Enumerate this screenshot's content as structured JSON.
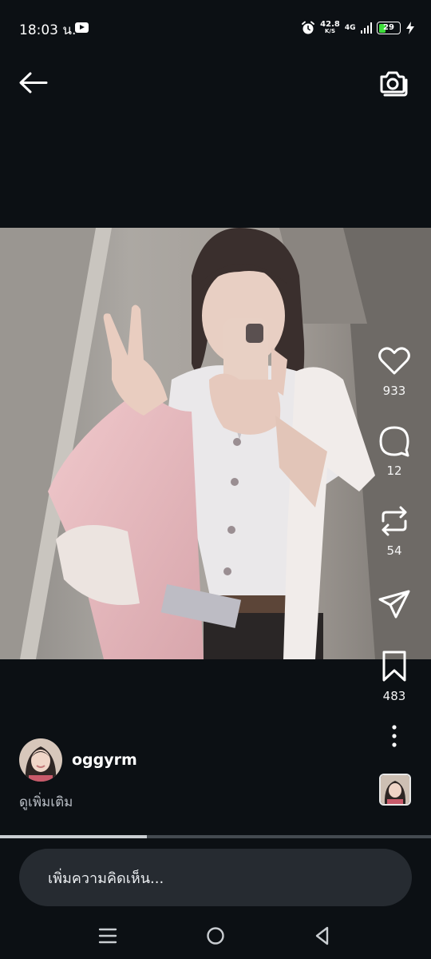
{
  "status_bar": {
    "time": "18:03 น.",
    "speed_value": "42.8",
    "speed_unit": "K/S",
    "network": "4G",
    "battery": "29"
  },
  "post": {
    "likes": "933",
    "comments": "12",
    "reposts": "54",
    "saves": "483",
    "username": "oggyrm",
    "see_more": "ดูเพิ่มเติม",
    "progress_fraction": 0.34
  },
  "comment": {
    "placeholder": "เพิ่มความคิดเห็น..."
  },
  "icons": {
    "back": "arrow-left-icon",
    "camera": "camera-icon",
    "like": "heart-icon",
    "comment": "comment-icon",
    "repost": "repost-icon",
    "share": "send-icon",
    "save": "bookmark-icon",
    "more": "more-vertical-icon"
  },
  "colors": {
    "background": "#0c1014",
    "battery": "#3ddc3a",
    "comment_box": "#262b31"
  }
}
